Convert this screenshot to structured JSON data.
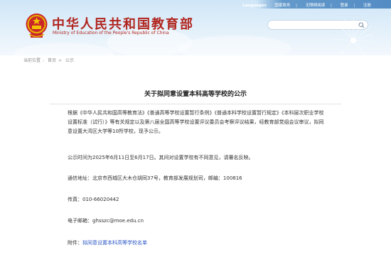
{
  "topbar": {
    "languages": "Languages",
    "items": [
      "国家政务",
      "无障碍阅读",
      "登录",
      "注册"
    ]
  },
  "header": {
    "title_cn": "中华人民共和国教育部",
    "title_en": "Ministry of Education of the People's Republic of China"
  },
  "search": {
    "value": ""
  },
  "breadcrumb": {
    "items": [
      "当前位置",
      "首页",
      "公示"
    ]
  },
  "article": {
    "title": "关于拟同意设置本科高等学校的公示",
    "paragraph1": "根据《中华人民共和国高等教育法》《普通高等学校设置暂行条例》《普通本科学校设置暂行规定》《本科层次职业学校设置标准（试行）》等有关规定以及第八届全国高等学校设置评议委员会考察评议结果，经教育部党组会议审议，拟同意设置大湾区大学等10所学校，现予公示。",
    "paragraph2": "公示时间为2025年6月11日至6月17日。其间对设置学校有不同意见，请署名反映。",
    "address_label": "通信地址：",
    "address_value": "北京市西城区大木仓胡同37号，教育部发展规划司，邮编：100816",
    "fax_label": "传真：",
    "fax_value": "010-66020442",
    "email_label": "电子邮箱：",
    "email_value": "ghsszc@moe.edu.cn",
    "attachment_label": "附件：",
    "attachment_link": "拟同意设置本科高等学校名单"
  },
  "colors": {
    "brand_red": "#b0251e",
    "link_blue": "#2b56c4",
    "sky": "#cfe6f8"
  }
}
